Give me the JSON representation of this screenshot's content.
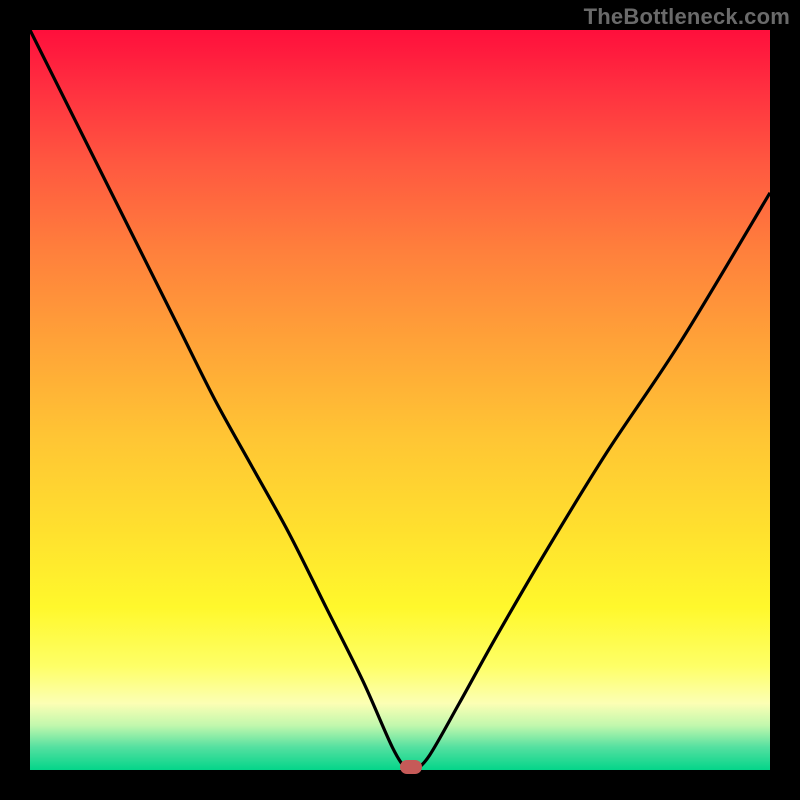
{
  "watermark": "TheBottleneck.com",
  "chart_data": {
    "type": "line",
    "title": "",
    "xlabel": "",
    "ylabel": "",
    "xlim": [
      0,
      100
    ],
    "ylim": [
      0,
      100
    ],
    "background_gradient": {
      "top_color": "#ff0f3c",
      "bottom_color": "#04d58a",
      "direction": "vertical"
    },
    "series": [
      {
        "name": "bottleneck-curve",
        "x": [
          0,
          5,
          10,
          15,
          20,
          25,
          30,
          35,
          40,
          45,
          49,
          51,
          52,
          54,
          58,
          63,
          70,
          78,
          88,
          100
        ],
        "y": [
          100,
          90,
          80,
          70,
          60,
          50,
          41,
          32,
          22,
          12,
          3,
          0,
          0,
          2,
          9,
          18,
          30,
          43,
          58,
          78
        ],
        "color": "#000000"
      }
    ],
    "annotations": [
      {
        "name": "min-marker",
        "shape": "rounded-rect",
        "x": 51.5,
        "y": 0,
        "color": "#c65a58"
      }
    ]
  }
}
